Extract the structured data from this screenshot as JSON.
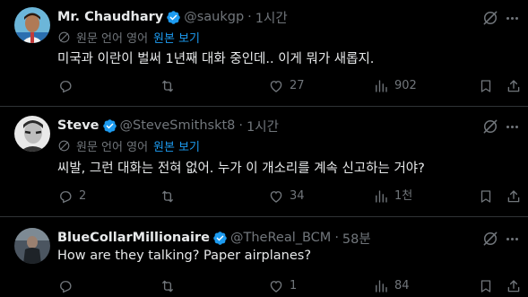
{
  "tweets": [
    {
      "name": "Mr. Chaudhary",
      "handle": "@saukgp",
      "separator": "·",
      "time": "1시간",
      "translated_from": "원문 언어 영어",
      "show_original": "원본 보기",
      "text": "미국과 이란이 벌써 1년째 대화 중인데.. 이게 뭐가 새롭지.",
      "replies": "",
      "retweets": "",
      "likes": "27",
      "views": "902"
    },
    {
      "name": "Steve",
      "handle": "@SteveSmithskt8",
      "separator": "·",
      "time": "1시간",
      "translated_from": "원문 언어 영어",
      "show_original": "원본 보기",
      "text": "씨발, 그런 대화는 전혀 없어. 누가 이 개소리를 계속 신고하는 거야?",
      "replies": "2",
      "retweets": "",
      "likes": "34",
      "views": "1천"
    },
    {
      "name": "BlueCollarMillionaire",
      "handle": "@TheReal_BCM",
      "separator": "·",
      "time": "58분",
      "text": "How are they talking? Paper airplanes?",
      "replies": "",
      "retweets": "",
      "likes": "1",
      "views": "84"
    }
  ],
  "icons": {
    "verified": "verified-badge-icon",
    "grok": "grok-icon",
    "more": "more-icon",
    "translate": "globe-icon",
    "reply": "reply-icon",
    "retweet": "retweet-icon",
    "like": "heart-icon",
    "views": "views-icon",
    "bookmark": "bookmark-icon",
    "share": "share-icon"
  },
  "colors": {
    "background": "#000000",
    "text": "#e7e9ea",
    "muted": "#71767b",
    "accent": "#1d9bf0",
    "divider": "#2f3336"
  }
}
